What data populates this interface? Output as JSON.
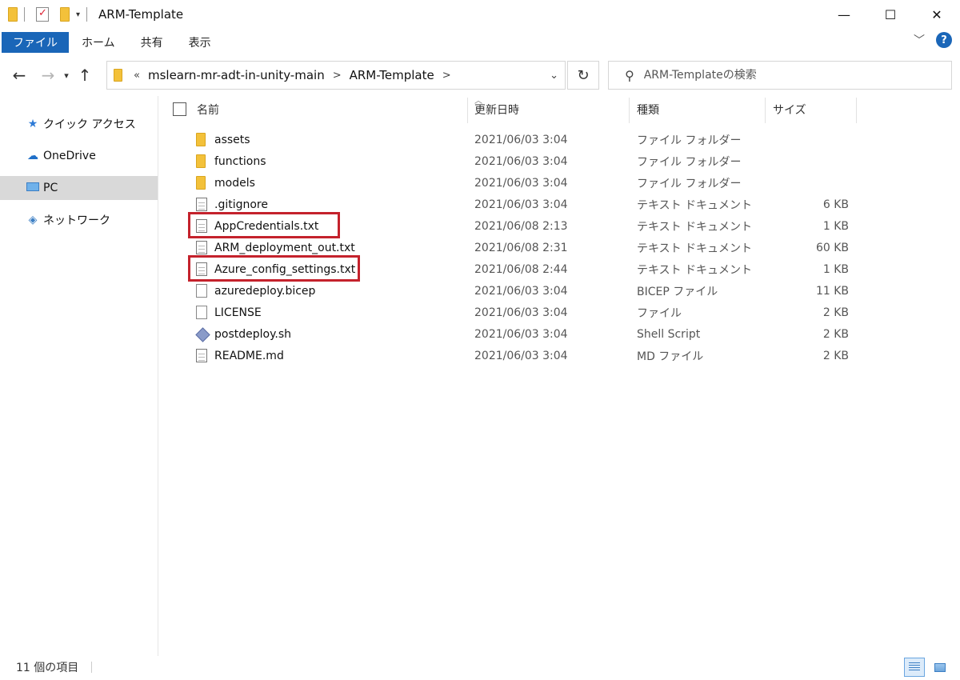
{
  "window": {
    "title": "ARM-Template",
    "minimize": "—",
    "maximize": "☐",
    "close": "✕"
  },
  "ribbon": {
    "tabs": [
      "ファイル",
      "ホーム",
      "共有",
      "表示"
    ],
    "help": "?"
  },
  "address": {
    "overflow": "«",
    "breadcrumbs": [
      "mslearn-mr-adt-in-unity-main",
      "ARM-Template"
    ],
    "separator": ">"
  },
  "search": {
    "placeholder": "ARM-Templateの検索"
  },
  "nav_pane": {
    "items": [
      {
        "label": "クイック アクセス",
        "icon": "star-icon"
      },
      {
        "label": "OneDrive",
        "icon": "cloud-icon"
      },
      {
        "label": "PC",
        "icon": "pc-icon",
        "selected": true
      },
      {
        "label": "ネットワーク",
        "icon": "network-icon"
      }
    ]
  },
  "columns": {
    "name": "名前",
    "date": "更新日時",
    "type": "種類",
    "size": "サイズ"
  },
  "files": [
    {
      "name": "assets",
      "date": "2021/06/03 3:04",
      "type": "ファイル フォルダー",
      "size": "",
      "icon": "folder-icon"
    },
    {
      "name": "functions",
      "date": "2021/06/03 3:04",
      "type": "ファイル フォルダー",
      "size": "",
      "icon": "folder-icon"
    },
    {
      "name": "models",
      "date": "2021/06/03 3:04",
      "type": "ファイル フォルダー",
      "size": "",
      "icon": "folder-icon"
    },
    {
      "name": ".gitignore",
      "date": "2021/06/03 3:04",
      "type": "テキスト ドキュメント",
      "size": "6 KB",
      "icon": "text-file-icon"
    },
    {
      "name": "AppCredentials.txt",
      "date": "2021/06/08 2:13",
      "type": "テキスト ドキュメント",
      "size": "1 KB",
      "icon": "text-file-icon",
      "highlighted": true
    },
    {
      "name": "ARM_deployment_out.txt",
      "date": "2021/06/08 2:31",
      "type": "テキスト ドキュメント",
      "size": "60 KB",
      "icon": "text-file-icon"
    },
    {
      "name": "Azure_config_settings.txt",
      "date": "2021/06/08 2:44",
      "type": "テキスト ドキュメント",
      "size": "1 KB",
      "icon": "text-file-icon",
      "highlighted": true
    },
    {
      "name": "azuredeploy.bicep",
      "date": "2021/06/03 3:04",
      "type": "BICEP ファイル",
      "size": "11 KB",
      "icon": "blank-file-icon"
    },
    {
      "name": "LICENSE",
      "date": "2021/06/03 3:04",
      "type": "ファイル",
      "size": "2 KB",
      "icon": "blank-file-icon"
    },
    {
      "name": "postdeploy.sh",
      "date": "2021/06/03 3:04",
      "type": "Shell Script",
      "size": "2 KB",
      "icon": "script-file-icon"
    },
    {
      "name": "README.md",
      "date": "2021/06/03 3:04",
      "type": "MD ファイル",
      "size": "2 KB",
      "icon": "text-file-icon"
    }
  ],
  "status": {
    "item_count": "11 個の項目"
  },
  "colors": {
    "file_tab": "#1a66b8",
    "highlight": "#c4222c",
    "nav_selected": "#d9d9d9"
  }
}
